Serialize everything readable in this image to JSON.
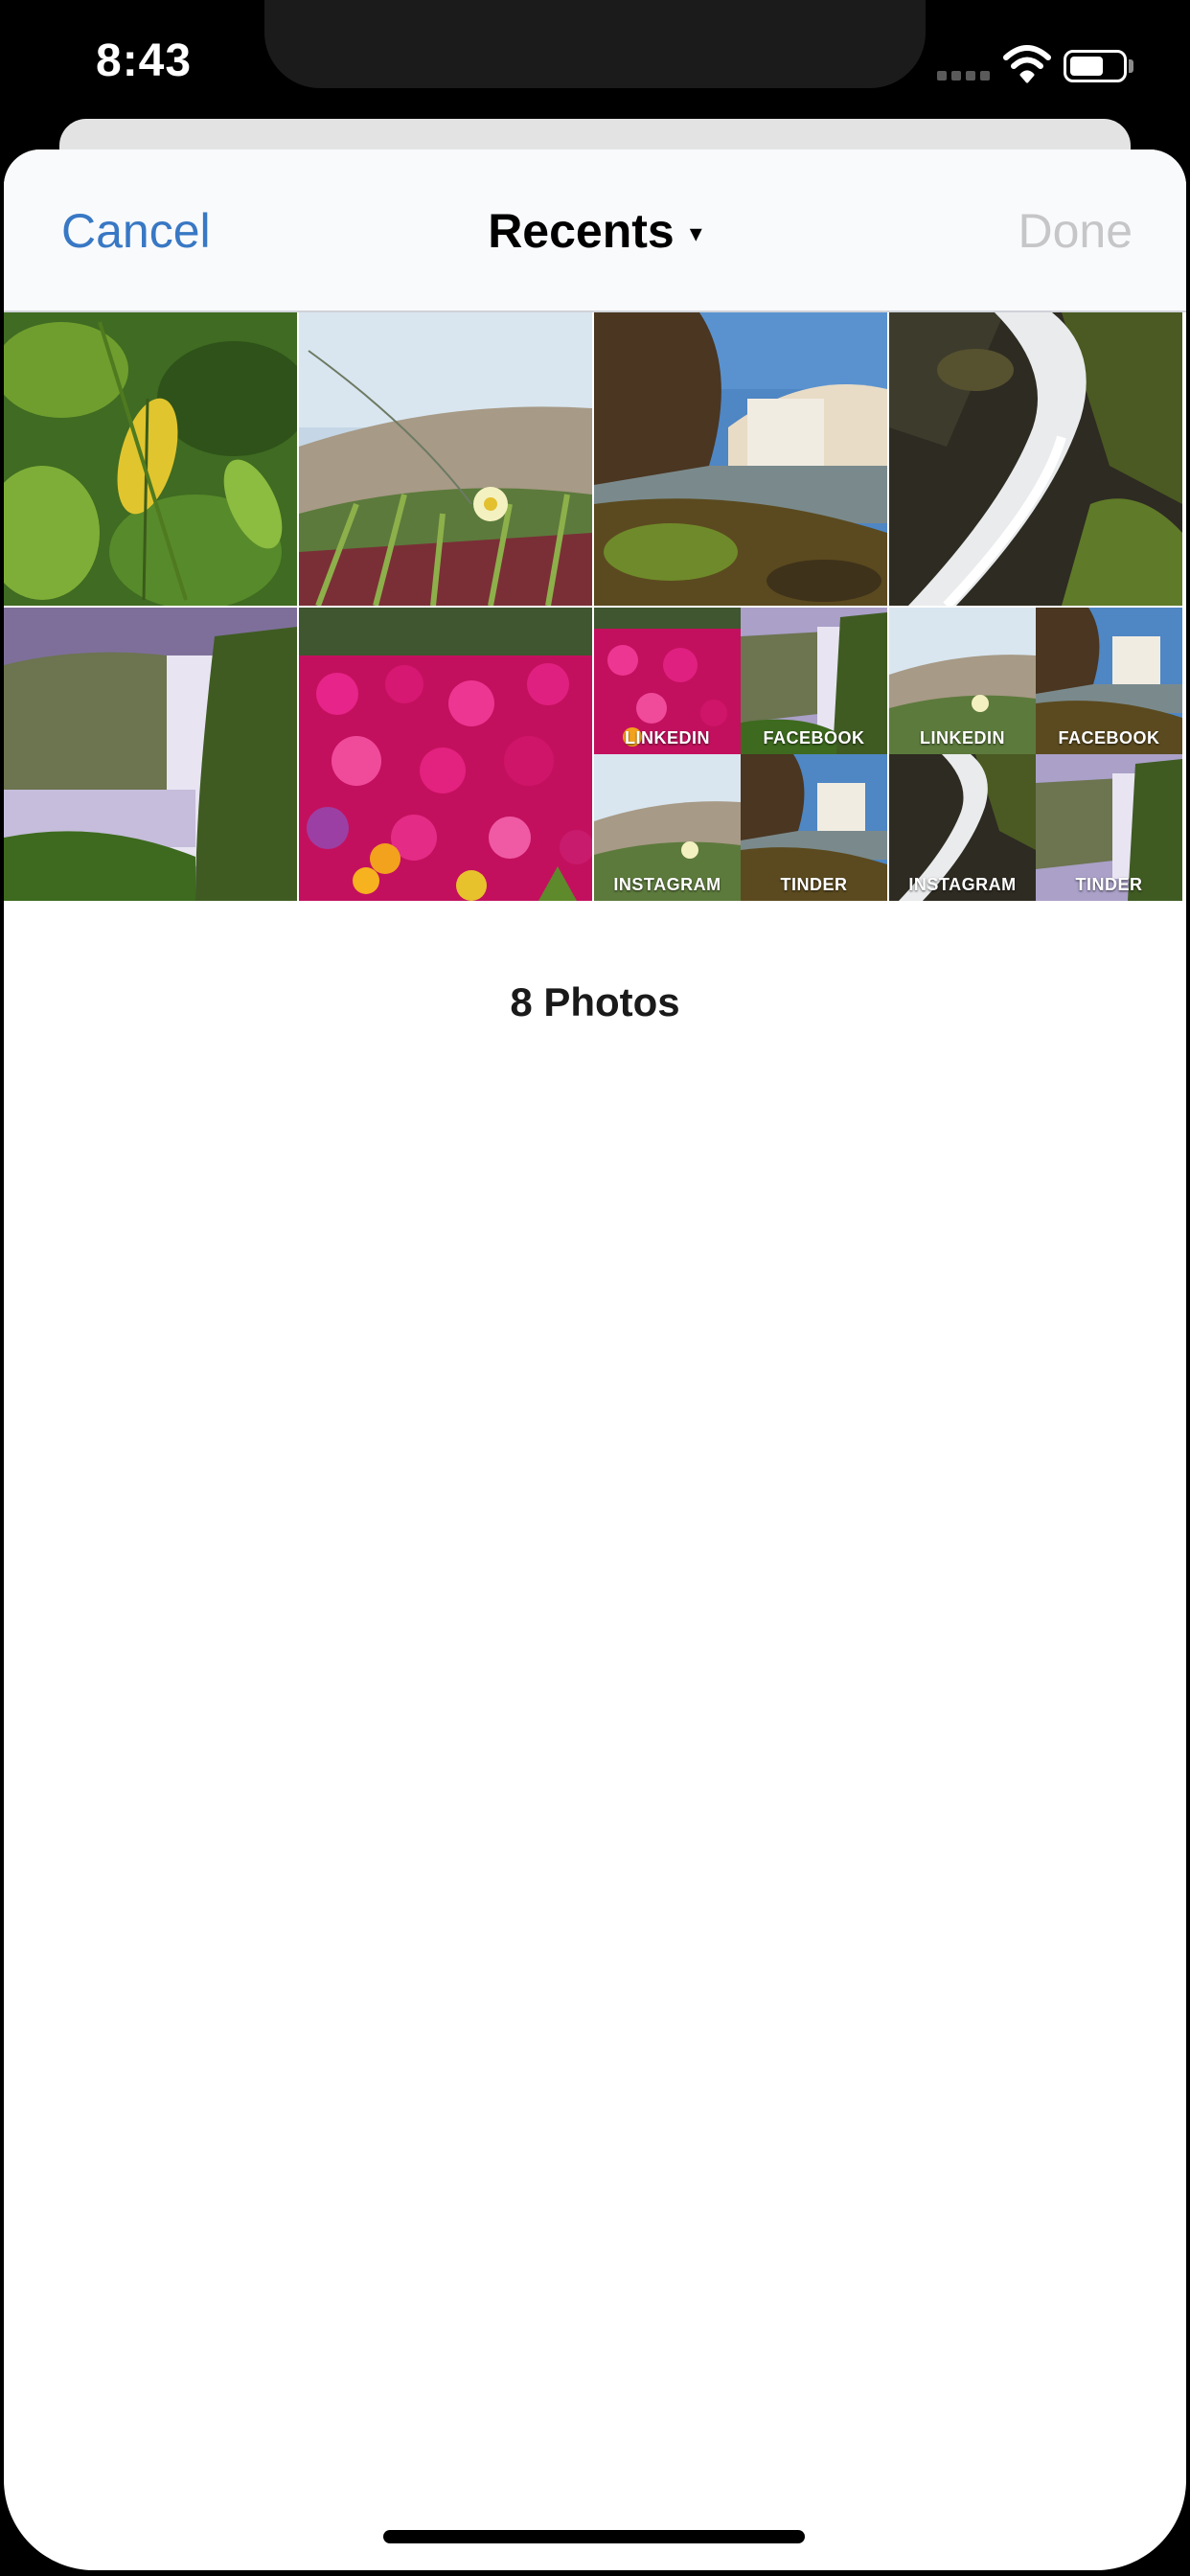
{
  "status_bar": {
    "time": "8:43",
    "icons": [
      "cellular-dots-icon",
      "wifi-icon",
      "battery-icon"
    ]
  },
  "nav": {
    "cancel_label": "Cancel",
    "title": "Recents",
    "title_caret": "▾",
    "done_label": "Done"
  },
  "colors": {
    "accent": "#3878c4",
    "disabled": "#c6c6c8",
    "nav_background": "#f9fafc"
  },
  "photos": [
    {
      "id": "leaves",
      "subject": "green leaves"
    },
    {
      "id": "dune-flower",
      "subject": "dune grass with yellow flower"
    },
    {
      "id": "waterfall-cliff",
      "subject": "waterfall with mossy cliff"
    },
    {
      "id": "long-exposure-falls",
      "subject": "long exposure waterfall"
    },
    {
      "id": "skogafoss",
      "subject": "tall waterfall with mist"
    },
    {
      "id": "pink-flowers",
      "subject": "pink and orange flowers"
    },
    {
      "id": "collage-1",
      "labels": [
        "LINKEDIN",
        "FACEBOOK",
        "INSTAGRAM",
        "TINDER"
      ]
    },
    {
      "id": "collage-2",
      "labels": [
        "LINKEDIN",
        "FACEBOOK",
        "INSTAGRAM",
        "TINDER"
      ]
    }
  ],
  "photo_count": "8 Photos"
}
